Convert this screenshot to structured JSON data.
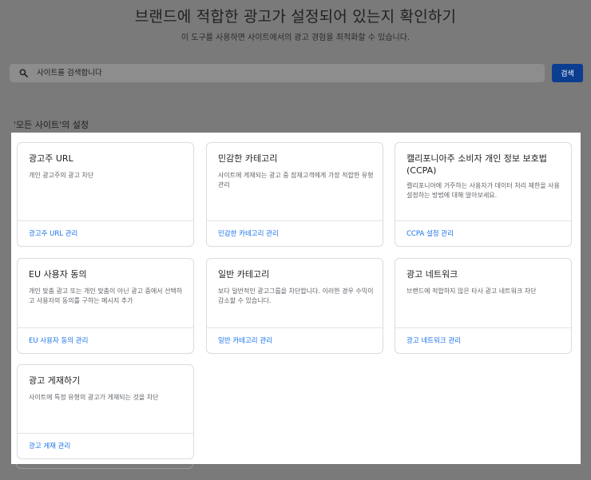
{
  "header": {
    "title": "브랜드에 적합한 광고가 설정되어 있는지 확인하기",
    "subtitle": "이 도구를 사용하면 사이트에서의 광고 경험을 최적화할 수 있습니다."
  },
  "search": {
    "placeholder": "사이트를 검색합니다",
    "button_label": "검색",
    "icon": "search-icon"
  },
  "section": {
    "title": "'모든 사이트'의 설정"
  },
  "cards": [
    {
      "title": "광고주 URL",
      "desc": "개인 광고주의 광고 차단",
      "link": "광고주 URL 관리"
    },
    {
      "title": "민감한 카테고리",
      "desc": "사이트에 게재되는 광고 중 잠재고객에게 가장 적합한 유형 관리",
      "link": "민감한 카테고리 관리"
    },
    {
      "title": "캘리포니아주 소비자 개인 정보 보호법 (CCPA)",
      "desc": "캘리포니아에 거주하는 사용자가 데이터 처리 제한을 사용 설정하는 방법에 대해 알아보세요.",
      "link": "CCPA 설정 관리"
    },
    {
      "title": "EU 사용자 동의",
      "desc": "개인 맞춤 광고 또는 개인 맞춤이 아닌 광고 중에서 선택하고 사용자의 동의를 구하는 메시지 추가",
      "link": "EU 사용자 동의 관리"
    },
    {
      "title": "일반 카테고리",
      "desc": "보다 일반적인 광고그룹을 차단합니다. 이러한 경우 수익이 감소할 수 있습니다.",
      "link": "일반 카테고리 관리"
    },
    {
      "title": "광고 네트워크",
      "desc": "브랜드에 적합하지 않은 타사 광고 네트워크 차단",
      "link": "광고 네트워크 관리"
    },
    {
      "title": "광고 게재하기",
      "desc": "사이트에 특정 유형의 광고가 게재되는 것을 차단",
      "link": "광고 게재 관리"
    }
  ]
}
